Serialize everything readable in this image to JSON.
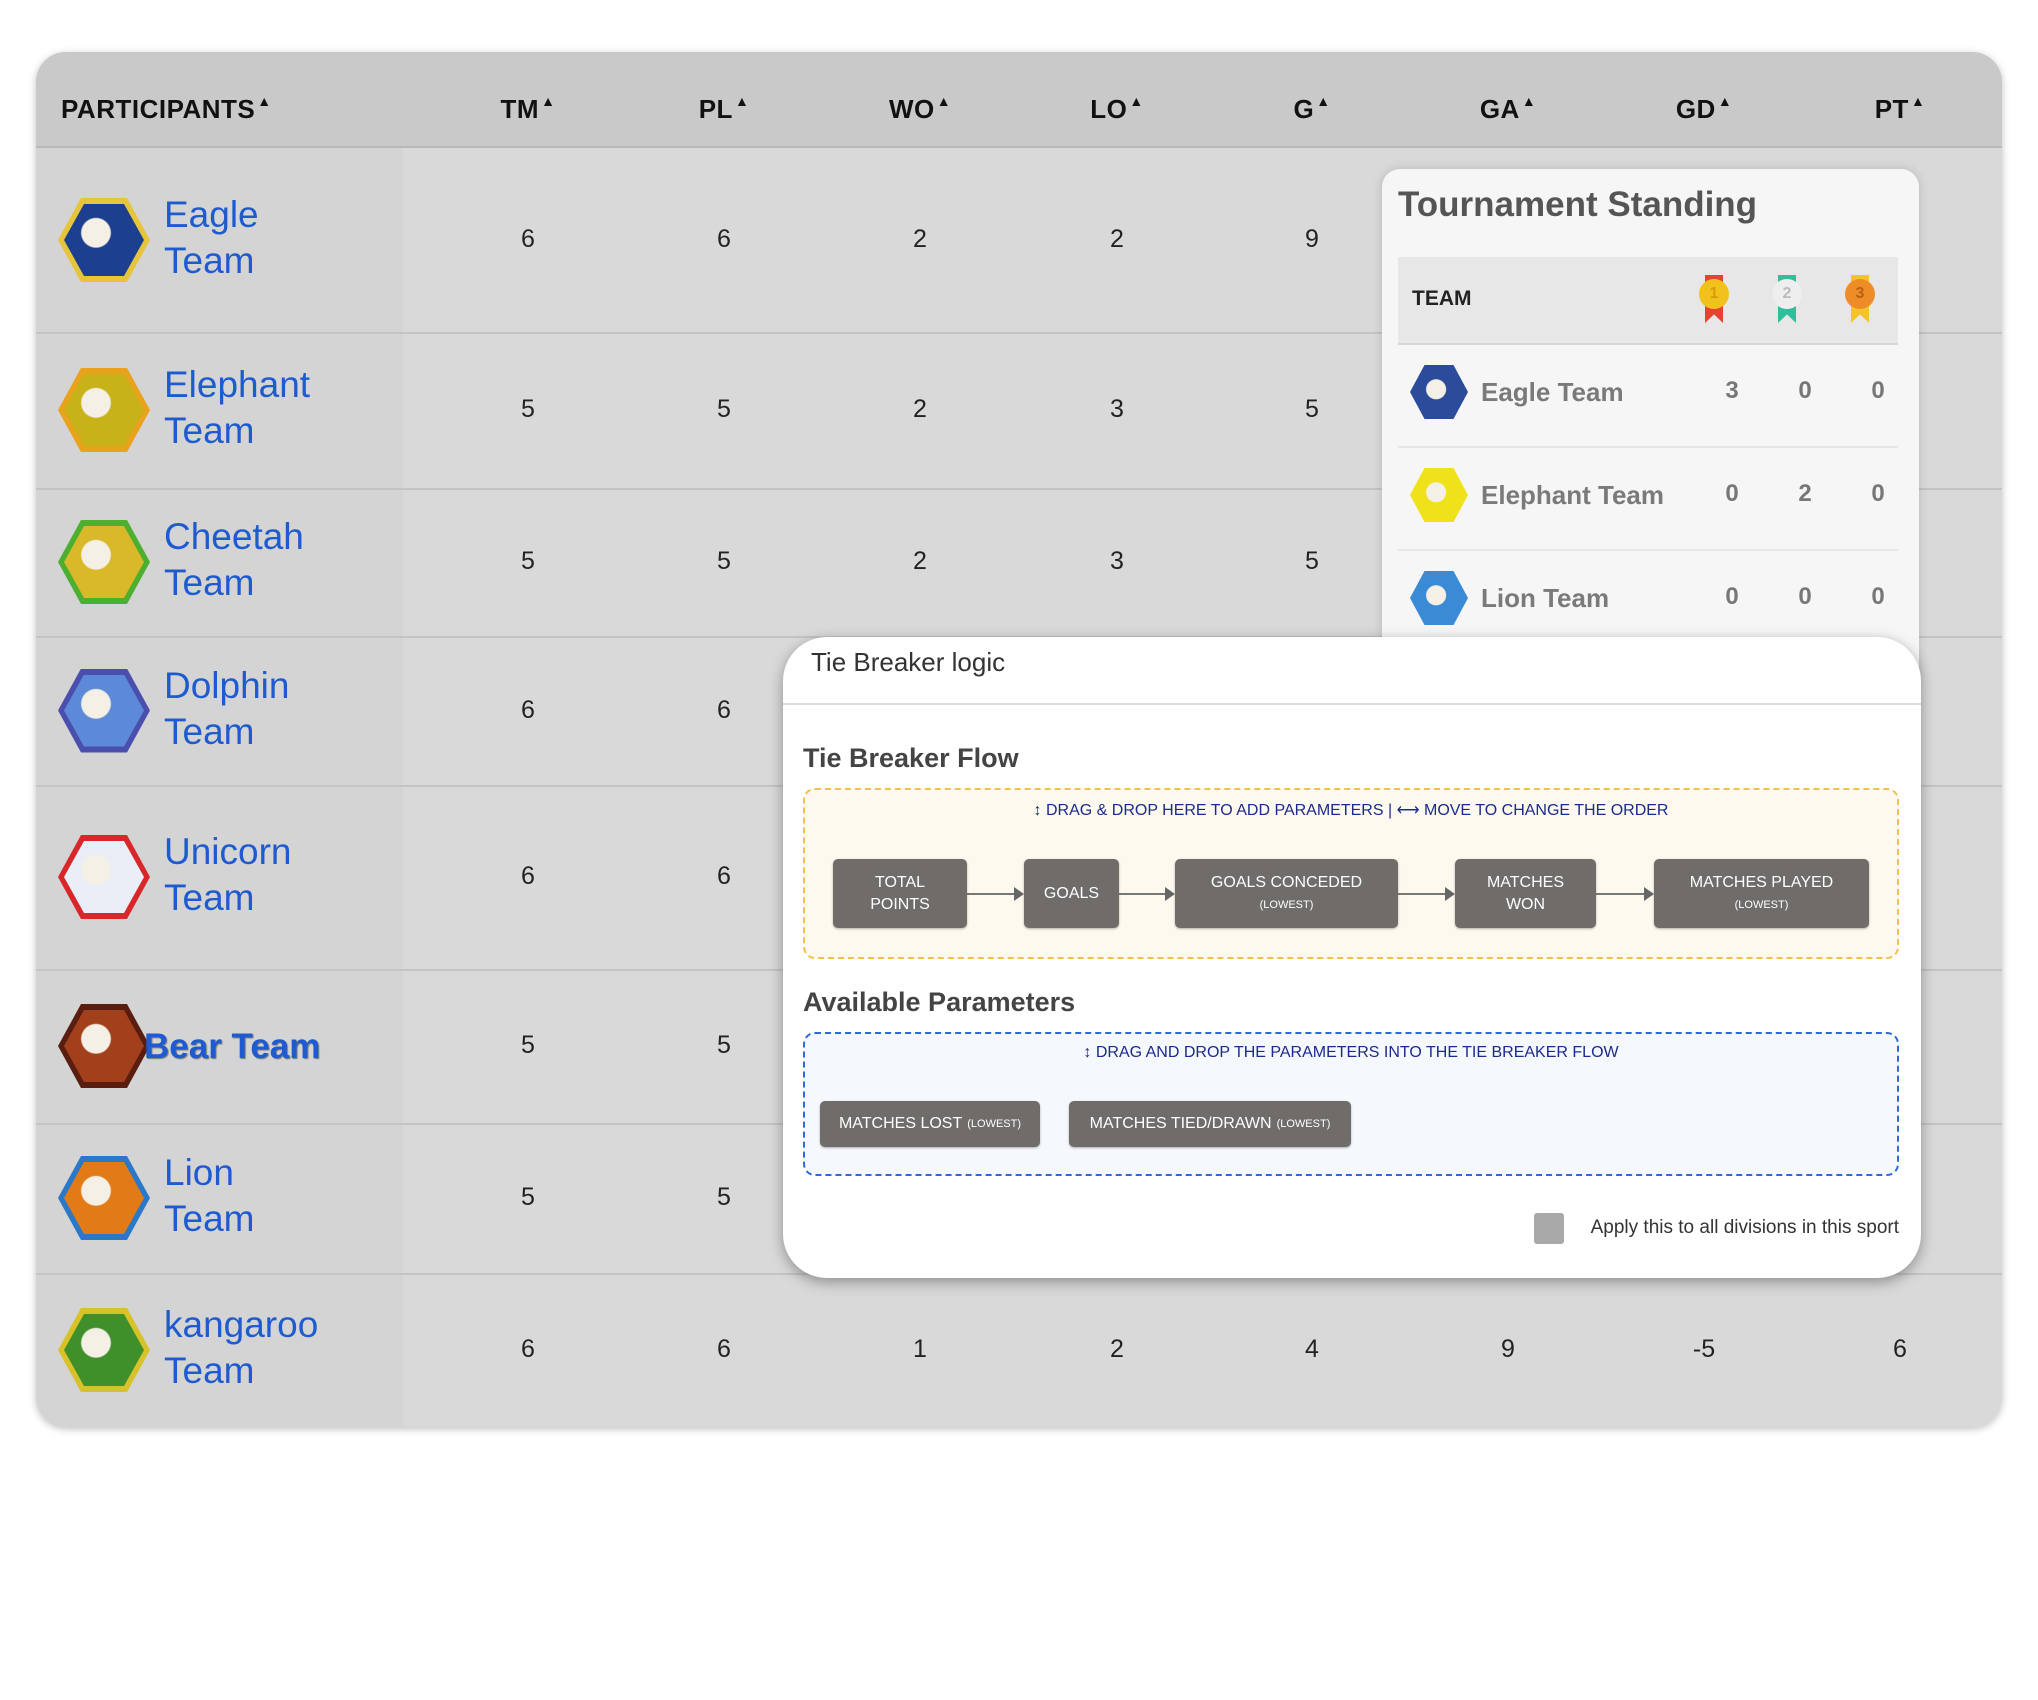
{
  "table": {
    "headers": {
      "participants": "PARTICIPANTS",
      "tm": "TM",
      "pl": "PL",
      "wo": "WO",
      "lo": "LO",
      "g": "G",
      "ga": "GA",
      "gd": "GD",
      "pt": "PT",
      "sort_icon": "▲"
    },
    "rows": [
      {
        "team_line1": "Eagle",
        "team_line2": "Team",
        "logo": "eagle-logo",
        "colors": [
          "#e7c53a",
          "#1d3f8f"
        ],
        "values": [
          "6",
          "6",
          "2",
          "2",
          "9",
          "",
          "",
          ""
        ]
      },
      {
        "team_line1": "Elephant",
        "team_line2": "Team",
        "logo": "elephant-logo",
        "colors": [
          "#e8a21c",
          "#c8b21a"
        ],
        "values": [
          "5",
          "5",
          "2",
          "3",
          "5",
          "",
          "",
          ""
        ]
      },
      {
        "team_line1": "Cheetah",
        "team_line2": "Team",
        "logo": "cheetah-logo",
        "colors": [
          "#4caf30",
          "#d9b82a"
        ],
        "values": [
          "5",
          "5",
          "2",
          "3",
          "5",
          "",
          "",
          ""
        ]
      },
      {
        "team_line1": "Dolphin",
        "team_line2": "Team",
        "logo": "dolphin-logo",
        "colors": [
          "#4a4fae",
          "#5c8ad8"
        ],
        "values": [
          "6",
          "6",
          "",
          "",
          "",
          "",
          "",
          ""
        ]
      },
      {
        "team_line1": "Unicorn",
        "team_line2": "Team",
        "logo": "unicorn-logo",
        "colors": [
          "#d8262a",
          "#e9eef7"
        ],
        "values": [
          "6",
          "6",
          "",
          "",
          "",
          "",
          "",
          ""
        ]
      },
      {
        "team_line1": "Bear Team",
        "team_line2": "",
        "logo": "bear-logo",
        "colors": [
          "#5a1e10",
          "#a2401c"
        ],
        "values": [
          "5",
          "5",
          "",
          "",
          "",
          "",
          "",
          ""
        ]
      },
      {
        "team_line1": "Lion",
        "team_line2": "Team",
        "logo": "lion-logo",
        "colors": [
          "#2c78c8",
          "#e27a16"
        ],
        "values": [
          "5",
          "5",
          "",
          "",
          "",
          "",
          "",
          ""
        ]
      },
      {
        "team_line1": "kangaroo",
        "team_line2": "Team",
        "logo": "kangaroo-logo",
        "colors": [
          "#d8c22a",
          "#3f8f2a"
        ],
        "values": [
          "6",
          "6",
          "1",
          "2",
          "4",
          "9",
          "-5",
          "6"
        ]
      }
    ]
  },
  "standing": {
    "title": "Tournament Standing",
    "team_header": "TEAM",
    "medals": [
      {
        "label": "1",
        "disc": "#f2c21c",
        "ribbon": "#e4432f",
        "text": "#d99a0a"
      },
      {
        "label": "2",
        "disc": "#eeeeee",
        "ribbon": "#2fbf9a",
        "text": "#bbbbbb"
      },
      {
        "label": "3",
        "disc": "#ee8d28",
        "ribbon": "#f6c42a",
        "text": "#b85e10"
      }
    ],
    "rows": [
      {
        "name": "Eagle Team",
        "gold": "3",
        "silver": "0",
        "bronze": "0",
        "colors": [
          "#d8374f",
          "#2b4c9b"
        ]
      },
      {
        "name": "Elephant Team",
        "gold": "0",
        "silver": "2",
        "bronze": "0",
        "colors": [
          "#1e5c6a",
          "#f0e21a"
        ]
      },
      {
        "name": "Lion Team",
        "gold": "0",
        "silver": "0",
        "bronze": "0",
        "colors": [
          "#e87c1a",
          "#3b8ad6"
        ]
      }
    ]
  },
  "modal": {
    "title": "Tie Breaker logic",
    "flow_title": "Tie Breaker Flow",
    "flow_hint_a": "DRAG & DROP HERE TO ADD PARAMETERS",
    "flow_hint_sep": "|",
    "flow_hint_b": "MOVE TO CHANGE THE ORDER",
    "flow": [
      {
        "line1": "TOTAL",
        "line2": "POINTS",
        "sub": ""
      },
      {
        "line1": "GOALS",
        "line2": "",
        "sub": ""
      },
      {
        "line1": "GOALS CONCEDED",
        "line2": "",
        "sub": "(LOWEST)"
      },
      {
        "line1": "MATCHES",
        "line2": "WON",
        "sub": ""
      },
      {
        "line1": "MATCHES PLAYED",
        "line2": "",
        "sub": "(LOWEST)"
      }
    ],
    "available_title": "Available Parameters",
    "available_hint": "DRAG AND DROP THE PARAMETERS INTO THE TIE BREAKER FLOW",
    "available": [
      {
        "label": "MATCHES LOST",
        "sub": "(LOWEST)"
      },
      {
        "label": "MATCHES TIED/DRAWN",
        "sub": "(LOWEST)"
      }
    ],
    "apply_label": "Apply this to all divisions in this sport",
    "apply_checked": false
  }
}
